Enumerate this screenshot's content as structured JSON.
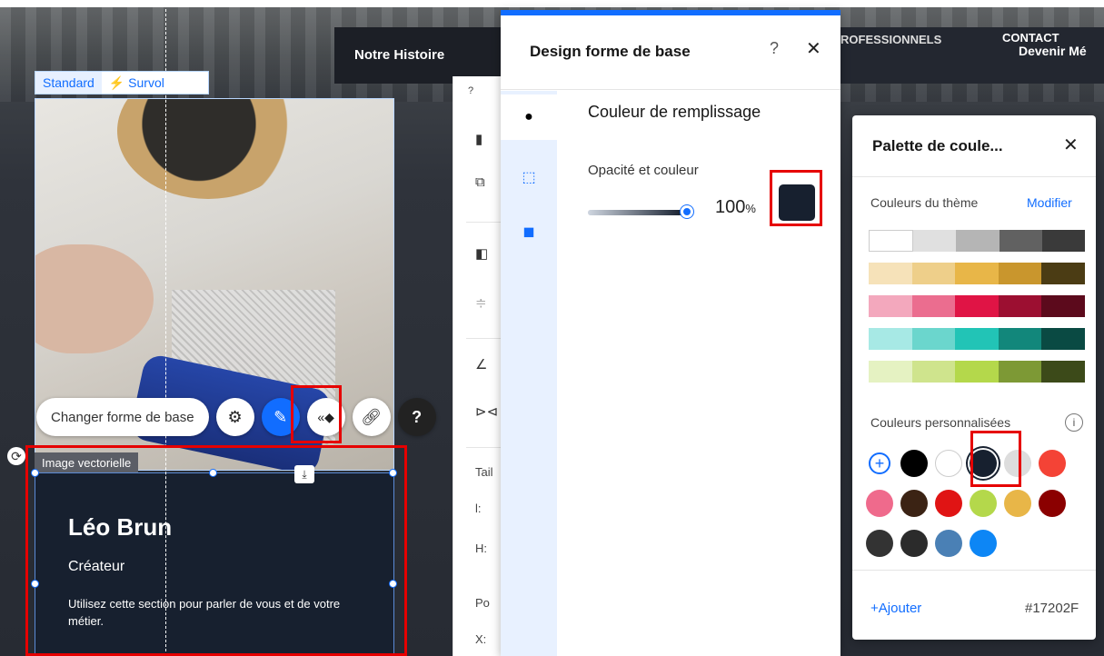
{
  "site": {
    "nav_left": "Notre Histoire",
    "nav_right_1": "ROFESSIONNELS",
    "nav_right_2": "CONTACT",
    "nav_right_3": "Devenir Mé"
  },
  "element_states": {
    "standard": "Standard",
    "hover": "Survol"
  },
  "toolbar": {
    "change_shape": "Changer forme de base",
    "settings_icon": "gear-icon",
    "design_icon": "brush-icon",
    "animation_icon": "animation-icon",
    "link_icon": "link-icon",
    "help_icon": "help-icon"
  },
  "vector_section": {
    "label": "Image vectorielle",
    "name": "Léo Brun",
    "role": "Créateur",
    "description": "Utilisez cette section pour parler de vous et de votre métier."
  },
  "prop_panel": {
    "help": "?",
    "size_label": "Tail",
    "width_label": "l:",
    "height_label": "H:",
    "position_label": "Po",
    "x_label": "X:"
  },
  "design_panel": {
    "title": "Design forme de base",
    "help": "?",
    "close": "✕",
    "section_title": "Couleur de remplissage",
    "opacity_label": "Opacité et couleur",
    "opacity_value": "100",
    "opacity_unit": "%",
    "opacity": 1.0,
    "fill_color": "#17202F"
  },
  "palette": {
    "title": "Palette de coule...",
    "close": "✕",
    "theme_label": "Couleurs du thème",
    "modify": "Modifier",
    "theme_rows": [
      [
        "#ffffff",
        "#e0e0e0",
        "#b5b5b5",
        "#616161",
        "#3a3a3a"
      ],
      [
        "#f6e2b9",
        "#eecf8a",
        "#e8b648",
        "#c9962d",
        "#4b3c14"
      ],
      [
        "#f3a8bd",
        "#eb6d8f",
        "#e01445",
        "#9c0f31",
        "#5c0a1c"
      ],
      [
        "#a7e9e5",
        "#6bd6cd",
        "#22c4b6",
        "#12877b",
        "#0a4a43"
      ],
      [
        "#e5f2c2",
        "#cfe48d",
        "#b4d84b",
        "#7d9935",
        "#3c4a19"
      ]
    ],
    "custom_label": "Couleurs personnalisées",
    "info": "i",
    "custom_colors": [
      "#000000",
      "#ffffff",
      "#17202f",
      "#dddddd",
      "#f44336",
      "#ef6a8c",
      "#3b2314",
      "#e01414",
      "#b4d84b",
      "#e8b648",
      "#8b0000",
      "#333333",
      "#2b2b2b",
      "#4a80b5",
      "#0d86f5"
    ],
    "add": "+Ajouter",
    "hex": "#17202F"
  }
}
